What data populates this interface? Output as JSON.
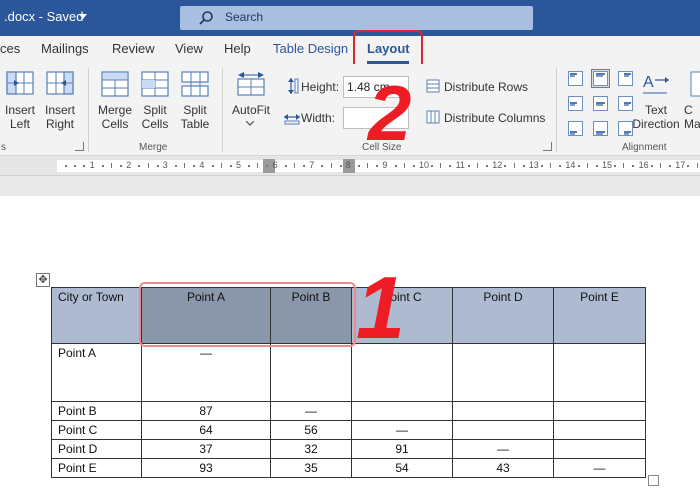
{
  "titlebar": {
    "doc_title": ".docx - Saved",
    "search_label": "Search"
  },
  "tabs": [
    "ces",
    "Mailings",
    "Review",
    "View",
    "Help",
    "Table Design",
    "Layout"
  ],
  "ribbon": {
    "insert_left": [
      "Insert",
      "Left"
    ],
    "insert_right": [
      "Insert",
      "Right"
    ],
    "merge_cells": [
      "Merge",
      "Cells"
    ],
    "split_cells": [
      "Split",
      "Cells"
    ],
    "split_table": [
      "Split",
      "Table"
    ],
    "autofit": "AutoFit",
    "height_label": "Height:",
    "height_value": "1.48 cm",
    "width_label": "Width:",
    "width_value": "",
    "distribute_rows": "Distribute Rows",
    "distribute_columns": "Distribute Columns",
    "text_direction": [
      "Text",
      "Direction"
    ],
    "cell_margins": [
      "C",
      "Ma"
    ],
    "group_rows": "s",
    "group_merge": "Merge",
    "group_cell_size": "Cell Size",
    "group_alignment": "Alignment"
  },
  "ruler": {
    "numbers": [
      "1",
      "2",
      "3",
      "4",
      "5",
      "6",
      "7",
      "8",
      "9",
      "10",
      "11",
      "12",
      "13",
      "14",
      "15",
      "16",
      "17"
    ]
  },
  "annotations": {
    "marker_1": "1",
    "marker_2": "2"
  },
  "table": {
    "headers": [
      "City or Town",
      "Point A",
      "Point B",
      "Point C",
      "Point D",
      "Point E"
    ],
    "rows": [
      [
        "Point A",
        "—",
        "",
        "",
        "",
        ""
      ],
      [
        "Point B",
        "87",
        "—",
        "",
        "",
        ""
      ],
      [
        "Point C",
        "64",
        "56",
        "—",
        "",
        ""
      ],
      [
        "Point D",
        "37",
        "32",
        "91",
        "—",
        ""
      ],
      [
        "Point E",
        "93",
        "35",
        "54",
        "43",
        "—"
      ]
    ]
  },
  "colors": {
    "title_bar": "#2b579a",
    "header_fill": "#aebad0",
    "selected_header": "#8a96aa",
    "annotation_red": "#ee1c25"
  }
}
